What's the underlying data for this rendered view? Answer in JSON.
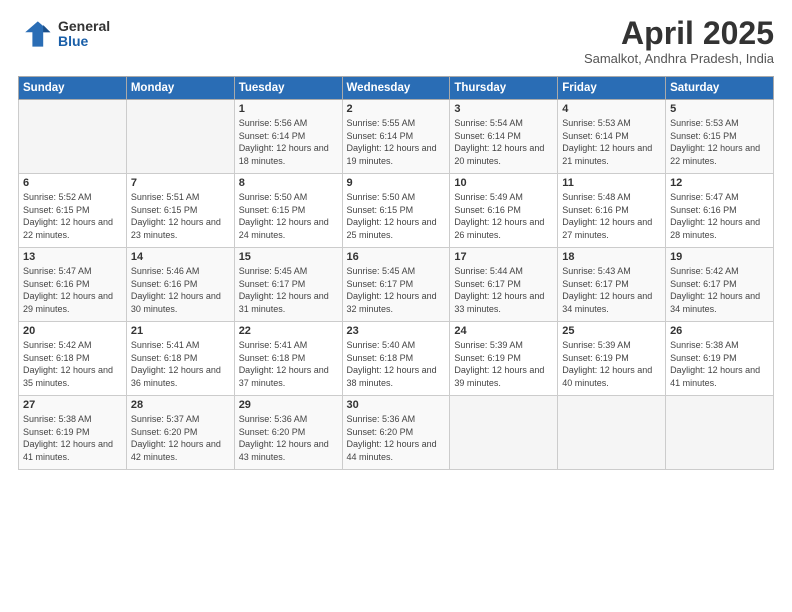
{
  "header": {
    "logo_general": "General",
    "logo_blue": "Blue",
    "month_title": "April 2025",
    "subtitle": "Samalkot, Andhra Pradesh, India"
  },
  "days_of_week": [
    "Sunday",
    "Monday",
    "Tuesday",
    "Wednesday",
    "Thursday",
    "Friday",
    "Saturday"
  ],
  "weeks": [
    [
      {
        "day": "",
        "sunrise": "",
        "sunset": "",
        "daylight": ""
      },
      {
        "day": "",
        "sunrise": "",
        "sunset": "",
        "daylight": ""
      },
      {
        "day": "1",
        "sunrise": "Sunrise: 5:56 AM",
        "sunset": "Sunset: 6:14 PM",
        "daylight": "Daylight: 12 hours and 18 minutes."
      },
      {
        "day": "2",
        "sunrise": "Sunrise: 5:55 AM",
        "sunset": "Sunset: 6:14 PM",
        "daylight": "Daylight: 12 hours and 19 minutes."
      },
      {
        "day": "3",
        "sunrise": "Sunrise: 5:54 AM",
        "sunset": "Sunset: 6:14 PM",
        "daylight": "Daylight: 12 hours and 20 minutes."
      },
      {
        "day": "4",
        "sunrise": "Sunrise: 5:53 AM",
        "sunset": "Sunset: 6:14 PM",
        "daylight": "Daylight: 12 hours and 21 minutes."
      },
      {
        "day": "5",
        "sunrise": "Sunrise: 5:53 AM",
        "sunset": "Sunset: 6:15 PM",
        "daylight": "Daylight: 12 hours and 22 minutes."
      }
    ],
    [
      {
        "day": "6",
        "sunrise": "Sunrise: 5:52 AM",
        "sunset": "Sunset: 6:15 PM",
        "daylight": "Daylight: 12 hours and 22 minutes."
      },
      {
        "day": "7",
        "sunrise": "Sunrise: 5:51 AM",
        "sunset": "Sunset: 6:15 PM",
        "daylight": "Daylight: 12 hours and 23 minutes."
      },
      {
        "day": "8",
        "sunrise": "Sunrise: 5:50 AM",
        "sunset": "Sunset: 6:15 PM",
        "daylight": "Daylight: 12 hours and 24 minutes."
      },
      {
        "day": "9",
        "sunrise": "Sunrise: 5:50 AM",
        "sunset": "Sunset: 6:15 PM",
        "daylight": "Daylight: 12 hours and 25 minutes."
      },
      {
        "day": "10",
        "sunrise": "Sunrise: 5:49 AM",
        "sunset": "Sunset: 6:16 PM",
        "daylight": "Daylight: 12 hours and 26 minutes."
      },
      {
        "day": "11",
        "sunrise": "Sunrise: 5:48 AM",
        "sunset": "Sunset: 6:16 PM",
        "daylight": "Daylight: 12 hours and 27 minutes."
      },
      {
        "day": "12",
        "sunrise": "Sunrise: 5:47 AM",
        "sunset": "Sunset: 6:16 PM",
        "daylight": "Daylight: 12 hours and 28 minutes."
      }
    ],
    [
      {
        "day": "13",
        "sunrise": "Sunrise: 5:47 AM",
        "sunset": "Sunset: 6:16 PM",
        "daylight": "Daylight: 12 hours and 29 minutes."
      },
      {
        "day": "14",
        "sunrise": "Sunrise: 5:46 AM",
        "sunset": "Sunset: 6:16 PM",
        "daylight": "Daylight: 12 hours and 30 minutes."
      },
      {
        "day": "15",
        "sunrise": "Sunrise: 5:45 AM",
        "sunset": "Sunset: 6:17 PM",
        "daylight": "Daylight: 12 hours and 31 minutes."
      },
      {
        "day": "16",
        "sunrise": "Sunrise: 5:45 AM",
        "sunset": "Sunset: 6:17 PM",
        "daylight": "Daylight: 12 hours and 32 minutes."
      },
      {
        "day": "17",
        "sunrise": "Sunrise: 5:44 AM",
        "sunset": "Sunset: 6:17 PM",
        "daylight": "Daylight: 12 hours and 33 minutes."
      },
      {
        "day": "18",
        "sunrise": "Sunrise: 5:43 AM",
        "sunset": "Sunset: 6:17 PM",
        "daylight": "Daylight: 12 hours and 34 minutes."
      },
      {
        "day": "19",
        "sunrise": "Sunrise: 5:42 AM",
        "sunset": "Sunset: 6:17 PM",
        "daylight": "Daylight: 12 hours and 34 minutes."
      }
    ],
    [
      {
        "day": "20",
        "sunrise": "Sunrise: 5:42 AM",
        "sunset": "Sunset: 6:18 PM",
        "daylight": "Daylight: 12 hours and 35 minutes."
      },
      {
        "day": "21",
        "sunrise": "Sunrise: 5:41 AM",
        "sunset": "Sunset: 6:18 PM",
        "daylight": "Daylight: 12 hours and 36 minutes."
      },
      {
        "day": "22",
        "sunrise": "Sunrise: 5:41 AM",
        "sunset": "Sunset: 6:18 PM",
        "daylight": "Daylight: 12 hours and 37 minutes."
      },
      {
        "day": "23",
        "sunrise": "Sunrise: 5:40 AM",
        "sunset": "Sunset: 6:18 PM",
        "daylight": "Daylight: 12 hours and 38 minutes."
      },
      {
        "day": "24",
        "sunrise": "Sunrise: 5:39 AM",
        "sunset": "Sunset: 6:19 PM",
        "daylight": "Daylight: 12 hours and 39 minutes."
      },
      {
        "day": "25",
        "sunrise": "Sunrise: 5:39 AM",
        "sunset": "Sunset: 6:19 PM",
        "daylight": "Daylight: 12 hours and 40 minutes."
      },
      {
        "day": "26",
        "sunrise": "Sunrise: 5:38 AM",
        "sunset": "Sunset: 6:19 PM",
        "daylight": "Daylight: 12 hours and 41 minutes."
      }
    ],
    [
      {
        "day": "27",
        "sunrise": "Sunrise: 5:38 AM",
        "sunset": "Sunset: 6:19 PM",
        "daylight": "Daylight: 12 hours and 41 minutes."
      },
      {
        "day": "28",
        "sunrise": "Sunrise: 5:37 AM",
        "sunset": "Sunset: 6:20 PM",
        "daylight": "Daylight: 12 hours and 42 minutes."
      },
      {
        "day": "29",
        "sunrise": "Sunrise: 5:36 AM",
        "sunset": "Sunset: 6:20 PM",
        "daylight": "Daylight: 12 hours and 43 minutes."
      },
      {
        "day": "30",
        "sunrise": "Sunrise: 5:36 AM",
        "sunset": "Sunset: 6:20 PM",
        "daylight": "Daylight: 12 hours and 44 minutes."
      },
      {
        "day": "",
        "sunrise": "",
        "sunset": "",
        "daylight": ""
      },
      {
        "day": "",
        "sunrise": "",
        "sunset": "",
        "daylight": ""
      },
      {
        "day": "",
        "sunrise": "",
        "sunset": "",
        "daylight": ""
      }
    ]
  ]
}
